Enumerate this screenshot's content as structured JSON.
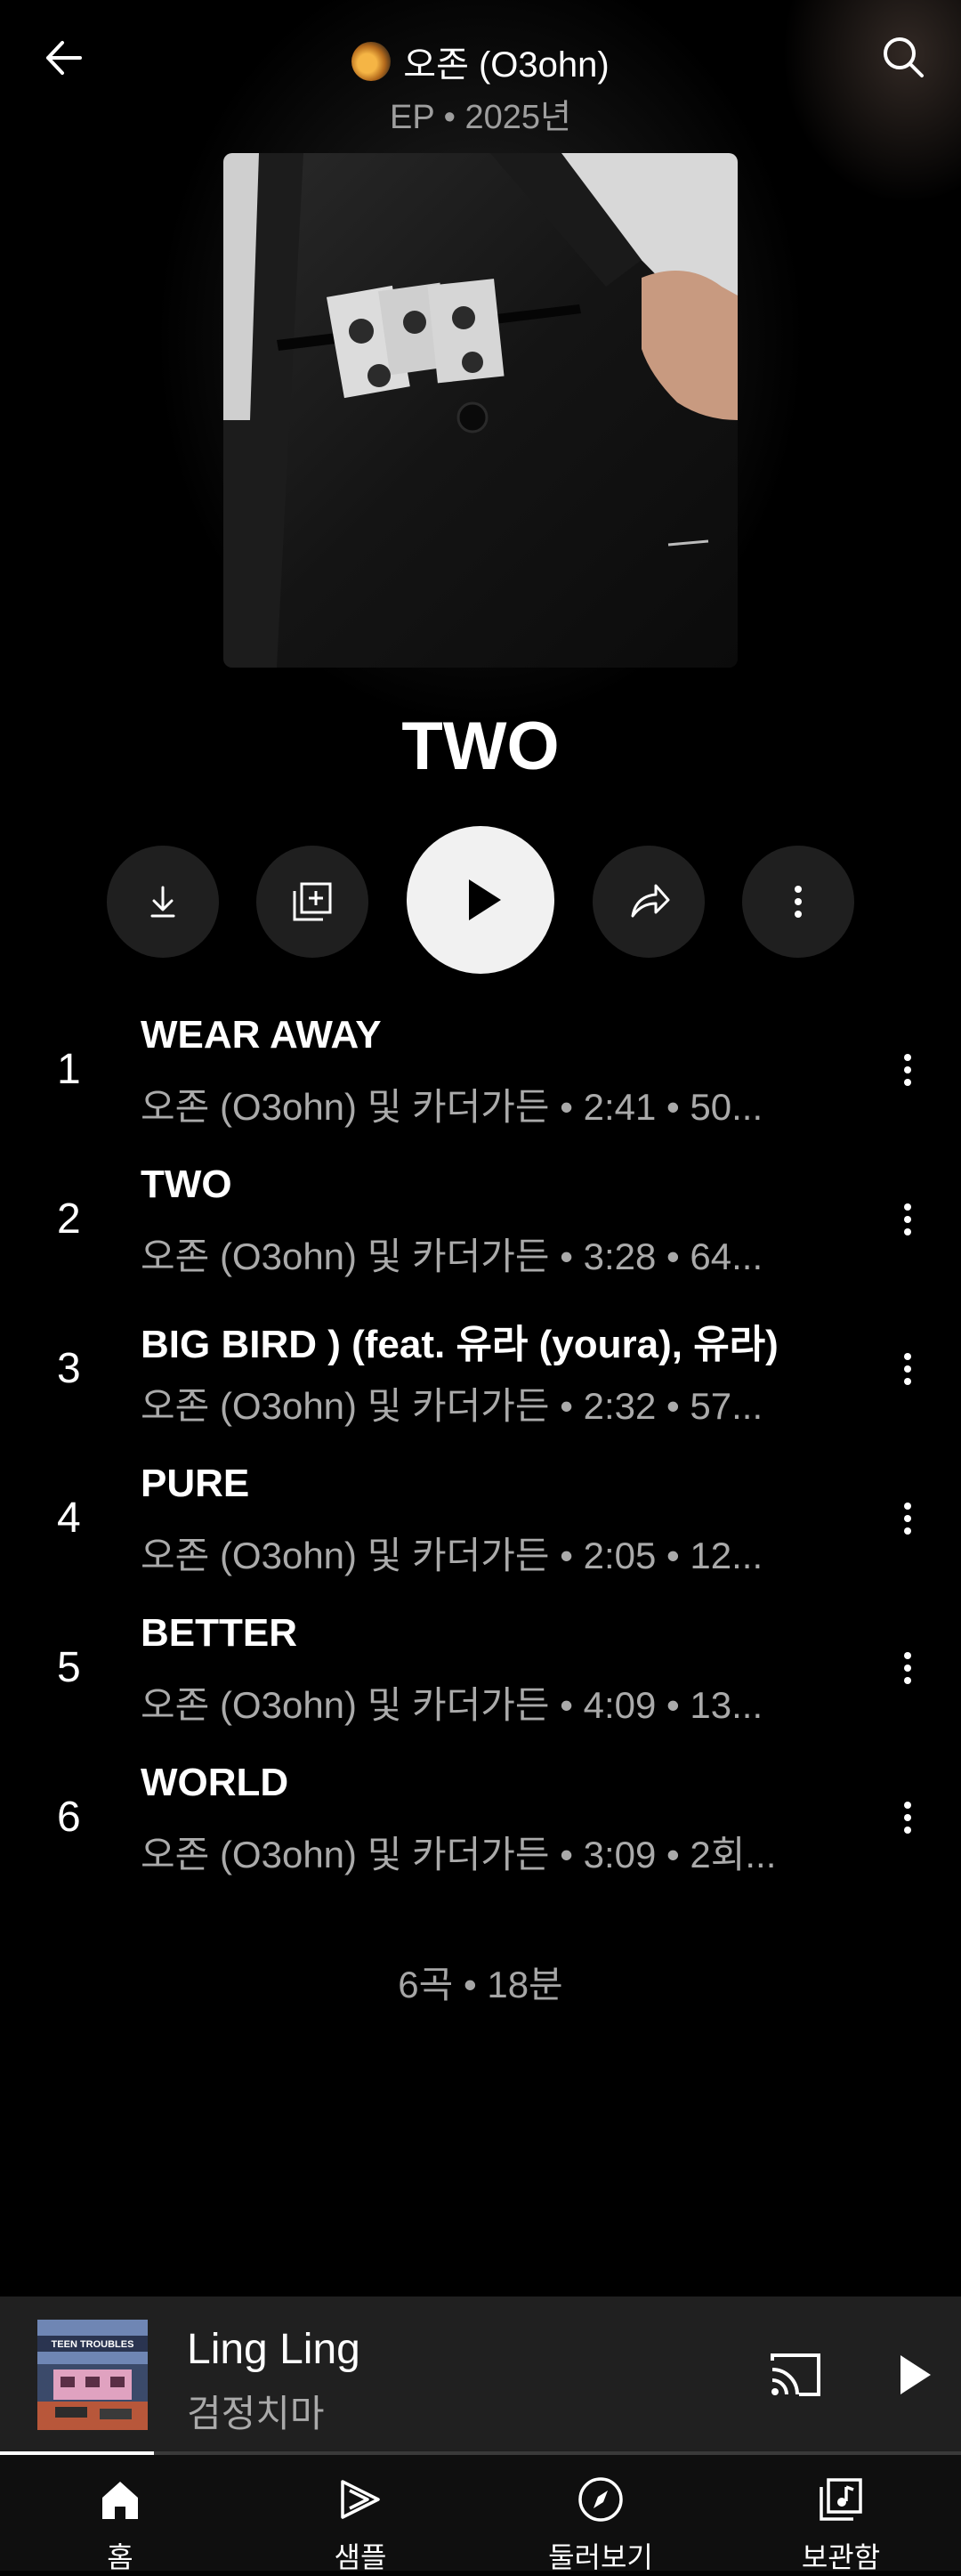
{
  "header": {
    "artist": "오존 (O3ohn)",
    "subtitle": "EP • 2025년"
  },
  "album": {
    "title": "TWO"
  },
  "tracks": [
    {
      "num": "1",
      "title": "WEAR AWAY",
      "meta": "오존 (O3ohn) 및 카더가든 • 2:41 • 50..."
    },
    {
      "num": "2",
      "title": "TWO",
      "meta": "오존 (O3ohn) 및 카더가든 • 3:28 • 64..."
    },
    {
      "num": "3",
      "title": "BIG BIRD ) (feat. 유라 (youra), 유라)",
      "meta": "오존 (O3ohn) 및 카더가든 • 2:32 • 57..."
    },
    {
      "num": "4",
      "title": "PURE",
      "meta": "오존 (O3ohn) 및 카더가든 • 2:05 • 12..."
    },
    {
      "num": "5",
      "title": "BETTER",
      "meta": "오존 (O3ohn) 및 카더가든 • 4:09 • 13..."
    },
    {
      "num": "6",
      "title": "WORLD",
      "meta": "오존 (O3ohn) 및 카더가든 • 3:09 • 2회..."
    }
  ],
  "summary": "6곡 • 18분",
  "mini_player": {
    "title": "Ling Ling",
    "artist": "검정치마",
    "art_text": "TEEN TROUBLES",
    "progress": 0.16
  },
  "nav": [
    {
      "label": "홈",
      "icon": "home-icon",
      "active": true
    },
    {
      "label": "샘플",
      "icon": "samples-icon",
      "active": false
    },
    {
      "label": "둘러보기",
      "icon": "explore-icon",
      "active": false
    },
    {
      "label": "보관함",
      "icon": "library-icon",
      "active": false
    }
  ],
  "colors": {
    "background": "#000000",
    "play_button": "#f1f1f1",
    "action_button": "#1f1f1f",
    "secondary_text": "#aaaaaa",
    "mini_player": "#202020"
  }
}
